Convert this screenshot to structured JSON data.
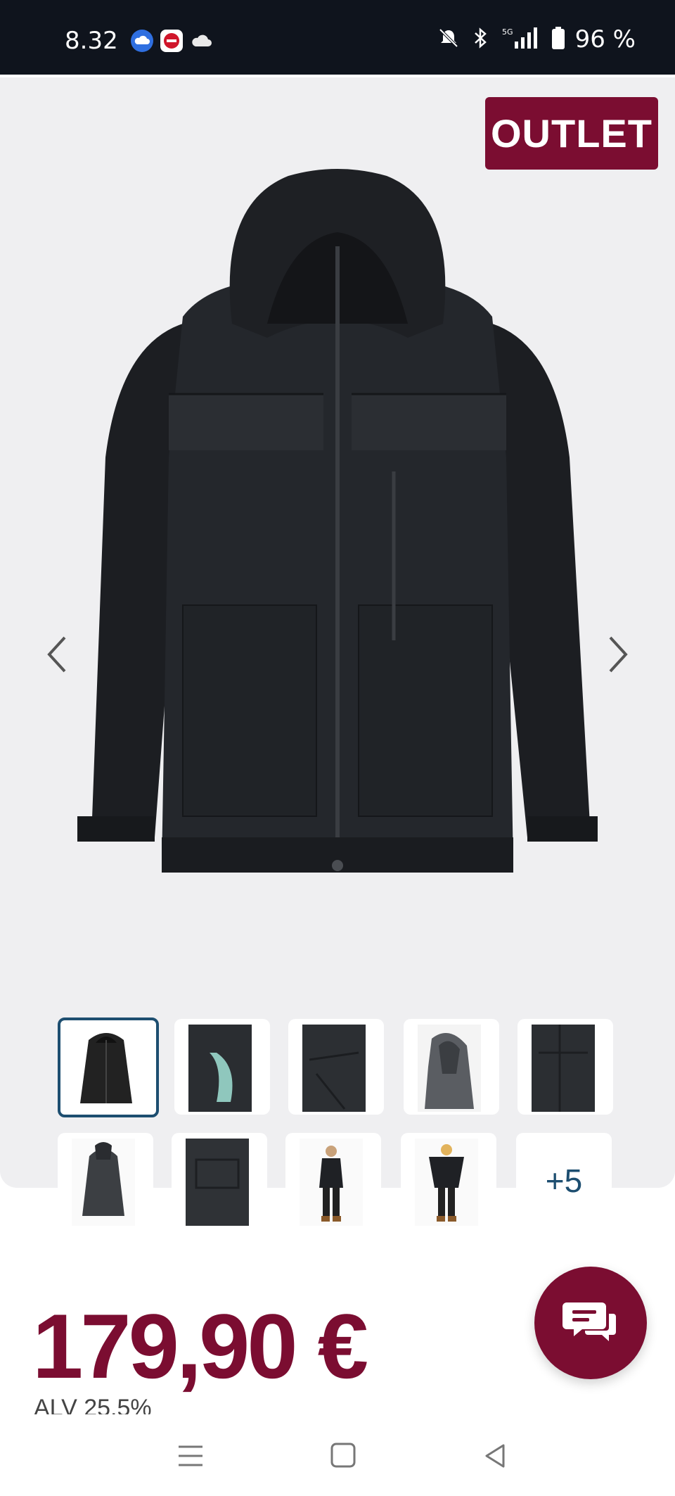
{
  "status_bar": {
    "time": "8.32",
    "battery": "96 %"
  },
  "product": {
    "badge": "OUTLET",
    "price": "179,90 €",
    "vat": "ALV 25,5%"
  },
  "gallery": {
    "more_count": "+5"
  },
  "colors": {
    "brand": "#7b0d31",
    "accent": "#1d4e70"
  }
}
